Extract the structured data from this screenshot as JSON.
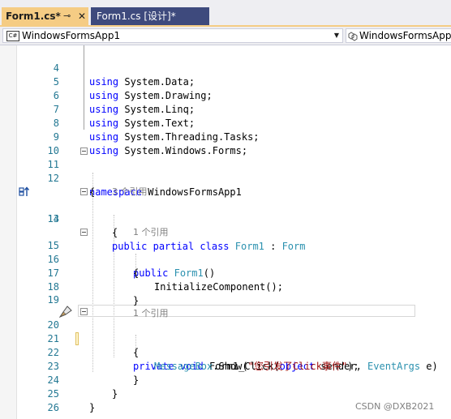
{
  "tabs": [
    {
      "label": "Form1.cs*",
      "pin_icon": "pin-icon",
      "close_icon": "close-icon",
      "active": true
    },
    {
      "label": "Form1.cs [设计]*",
      "active": false
    }
  ],
  "nav": {
    "project": "WindowsFormsApp1",
    "project_icon_text": "C#",
    "type": "WindowsFormsApp1"
  },
  "code_lines": [
    {
      "n": "4",
      "text": "using System.Data;"
    },
    {
      "n": "5",
      "text": "using System.Drawing;"
    },
    {
      "n": "6",
      "text": "using System.Linq;"
    },
    {
      "n": "7",
      "text": "using System.Text;"
    },
    {
      "n": "8",
      "text": "using System.Threading.Tasks;"
    },
    {
      "n": "9",
      "text": "using System.Windows.Forms;"
    },
    {
      "n": "10",
      "text": ""
    },
    {
      "n": "11",
      "text": "namespace WindowsFormsApp1"
    },
    {
      "n": "12",
      "text": "{"
    },
    {
      "n": "",
      "text": "3 个引用"
    },
    {
      "n": "13",
      "text": "public partial class Form1 : Form"
    },
    {
      "n": "14",
      "text": "{"
    },
    {
      "n": "",
      "text": "1 个引用"
    },
    {
      "n": "15",
      "text": "public Form1()"
    },
    {
      "n": "16",
      "text": "{"
    },
    {
      "n": "17",
      "text": "InitializeComponent();"
    },
    {
      "n": "18",
      "text": "}"
    },
    {
      "n": "19",
      "text": ""
    },
    {
      "n": "",
      "text": "1 个引用"
    },
    {
      "n": "20",
      "text": "private void Form1_Click(object sender, EventArgs e)"
    },
    {
      "n": "21",
      "text": "{"
    },
    {
      "n": "22",
      "text": "MessageBox.Show(\"您引发了Click事件\");"
    },
    {
      "n": "23",
      "text": "}"
    },
    {
      "n": "24",
      "text": "}"
    },
    {
      "n": "25",
      "text": "}"
    },
    {
      "n": "26",
      "text": ""
    }
  ],
  "watermark": "CSDN @DXB2021",
  "colors": {
    "keyword": "#0000ff",
    "type": "#2b91af",
    "string": "#a31515",
    "line_number": "#237893",
    "active_tab": "#f5cc84",
    "inactive_tab": "#3e4a7d"
  }
}
